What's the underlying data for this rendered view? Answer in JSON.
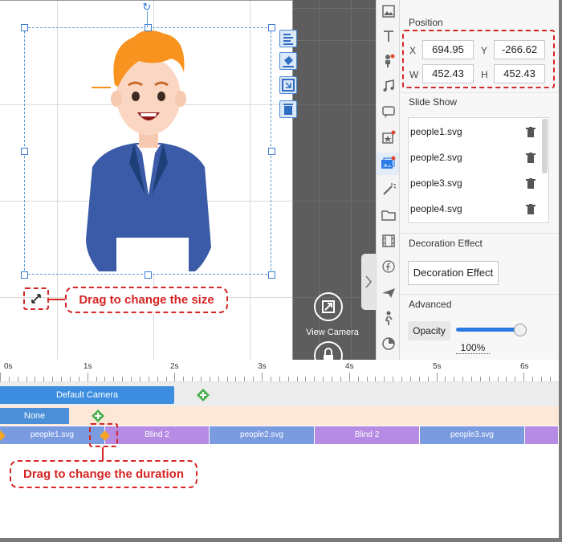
{
  "canvas": {
    "tools": [
      "align-icon",
      "fill-icon",
      "fit-icon",
      "delete-icon"
    ]
  },
  "annotations": {
    "resize_callout": "Drag to change the size",
    "duration_callout": "Drag to change the duration"
  },
  "camera_view": {
    "label": "View Camera"
  },
  "position": {
    "title": "Position",
    "x_label": "X",
    "x_value": "694.95",
    "y_label": "Y",
    "y_value": "-266.62",
    "w_label": "W",
    "w_value": "452.43",
    "h_label": "H",
    "h_value": "452.43"
  },
  "slide_show": {
    "title": "Slide Show",
    "items": [
      "people1.svg",
      "people2.svg",
      "people3.svg",
      "people4.svg"
    ]
  },
  "decoration": {
    "title": "Decoration Effect",
    "button": "Decoration Effect"
  },
  "advanced": {
    "title": "Advanced",
    "opacity_label": "Opacity",
    "opacity_value": "100%",
    "opacity_level": 1.0
  },
  "timeline": {
    "ruler": [
      "0s",
      "1s",
      "2s",
      "3s",
      "4s",
      "5s",
      "6s"
    ],
    "camera_track": "Default Camera",
    "effect_track": "None",
    "slides": [
      "people1.svg",
      "Blind 2",
      "people2.svg",
      "Blind 2",
      "people3.svg"
    ]
  },
  "colors": {
    "accent": "#2c7be5",
    "callout": "#d62525",
    "camera_track": "#3d8ee0",
    "transition": "#b58be3"
  }
}
